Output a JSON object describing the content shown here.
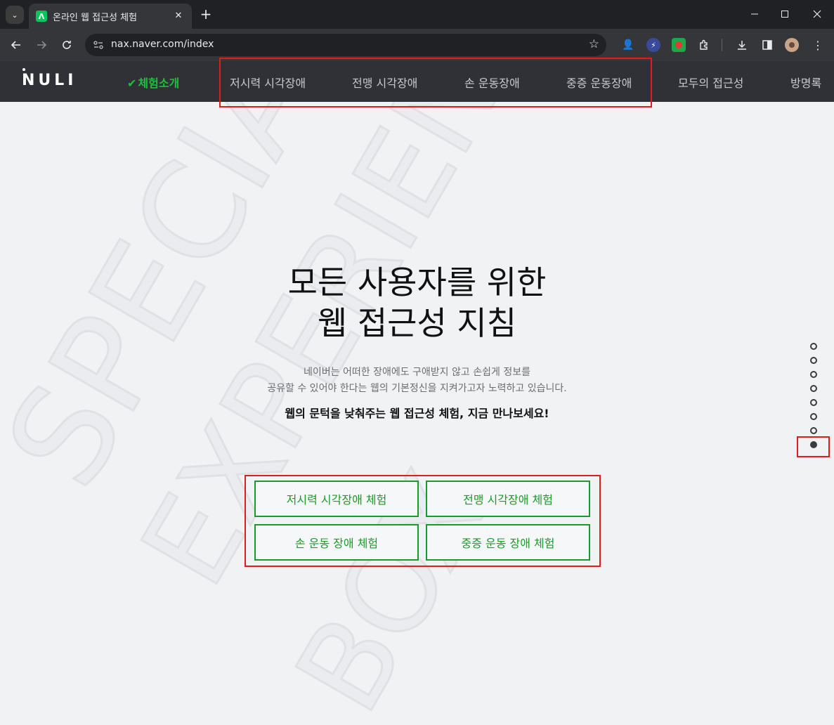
{
  "browser": {
    "tab_title": "온라인 웹 접근성 체험",
    "url": "nax.naver.com/index",
    "favicon_letter": "Λ"
  },
  "site": {
    "logo": "NULI",
    "nav": [
      {
        "label": "체험소개",
        "active": true
      },
      {
        "label": "저시력 시각장애",
        "active": false
      },
      {
        "label": "전맹 시각장애",
        "active": false
      },
      {
        "label": "손 운동장애",
        "active": false
      },
      {
        "label": "중증 운동장애",
        "active": false
      },
      {
        "label": "모두의 접근성",
        "active": false
      },
      {
        "label": "방명록",
        "active": false
      }
    ]
  },
  "hero": {
    "title_line1": "모든 사용자를 위한",
    "title_line2": "웹 접근성 지침",
    "desc_line1": "네이버는 어떠한 장애에도 구애받지 않고 손쉽게 정보를",
    "desc_line2": "공유할 수 있어야 한다는 웹의 기본정신을 지켜가고자 노력하고 있습니다.",
    "strong": "웹의 문턱을 낮춰주는 웹 접근성 체험, 지금 만나보세요!",
    "background_words": [
      "SPECIAL",
      "EXPERIENCE",
      "BOX"
    ]
  },
  "cta": [
    {
      "label": "저시력 시각장애 체험"
    },
    {
      "label": "전맹 시각장애 체험"
    },
    {
      "label": "손 운동 장애 체험"
    },
    {
      "label": "중증 운동 장애 체험"
    }
  ],
  "pager": {
    "total": 8,
    "active_index": 7
  },
  "colors": {
    "accent_green": "#1a9a28",
    "highlight_red": "#e21b1b",
    "header_bg": "#2f3136"
  }
}
